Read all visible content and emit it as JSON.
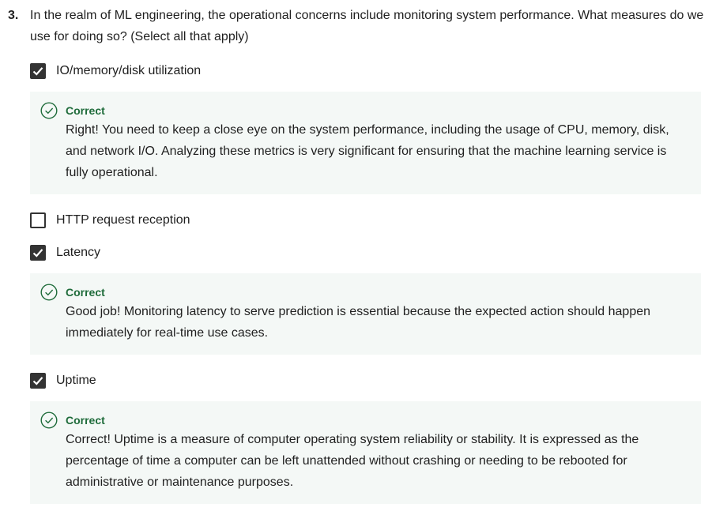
{
  "question": {
    "number": "3.",
    "text": "In the realm of ML engineering, the operational concerns include monitoring system performance. What measures do we use for doing so? (Select all that apply)"
  },
  "options": [
    {
      "label": "IO/memory/disk utilization",
      "checked": true,
      "feedback": {
        "status": "Correct",
        "text": "Right! You need to keep a close eye on the system performance, including the usage of CPU, memory, disk, and network I/O. Analyzing these metrics is very significant for ensuring that the machine learning service is fully operational."
      }
    },
    {
      "label": "HTTP request reception",
      "checked": false
    },
    {
      "label": "Latency",
      "checked": true,
      "feedback": {
        "status": "Correct",
        "text": "Good job! Monitoring latency to serve prediction is essential because the expected action should happen immediately for real-time use cases."
      }
    },
    {
      "label": "Uptime",
      "checked": true,
      "feedback": {
        "status": "Correct",
        "text": "Correct! Uptime is a measure of computer operating system reliability or stability. It is expressed as the percentage of time a computer can be left unattended without crashing or needing to be rebooted for administrative or maintenance purposes."
      }
    }
  ],
  "colors": {
    "correct": "#1e6b3a",
    "feedback_bg": "#f4f8f6",
    "checkbox": "#333333"
  },
  "icons": {
    "checked": "checkmark-icon",
    "correct": "check-circle-icon"
  }
}
